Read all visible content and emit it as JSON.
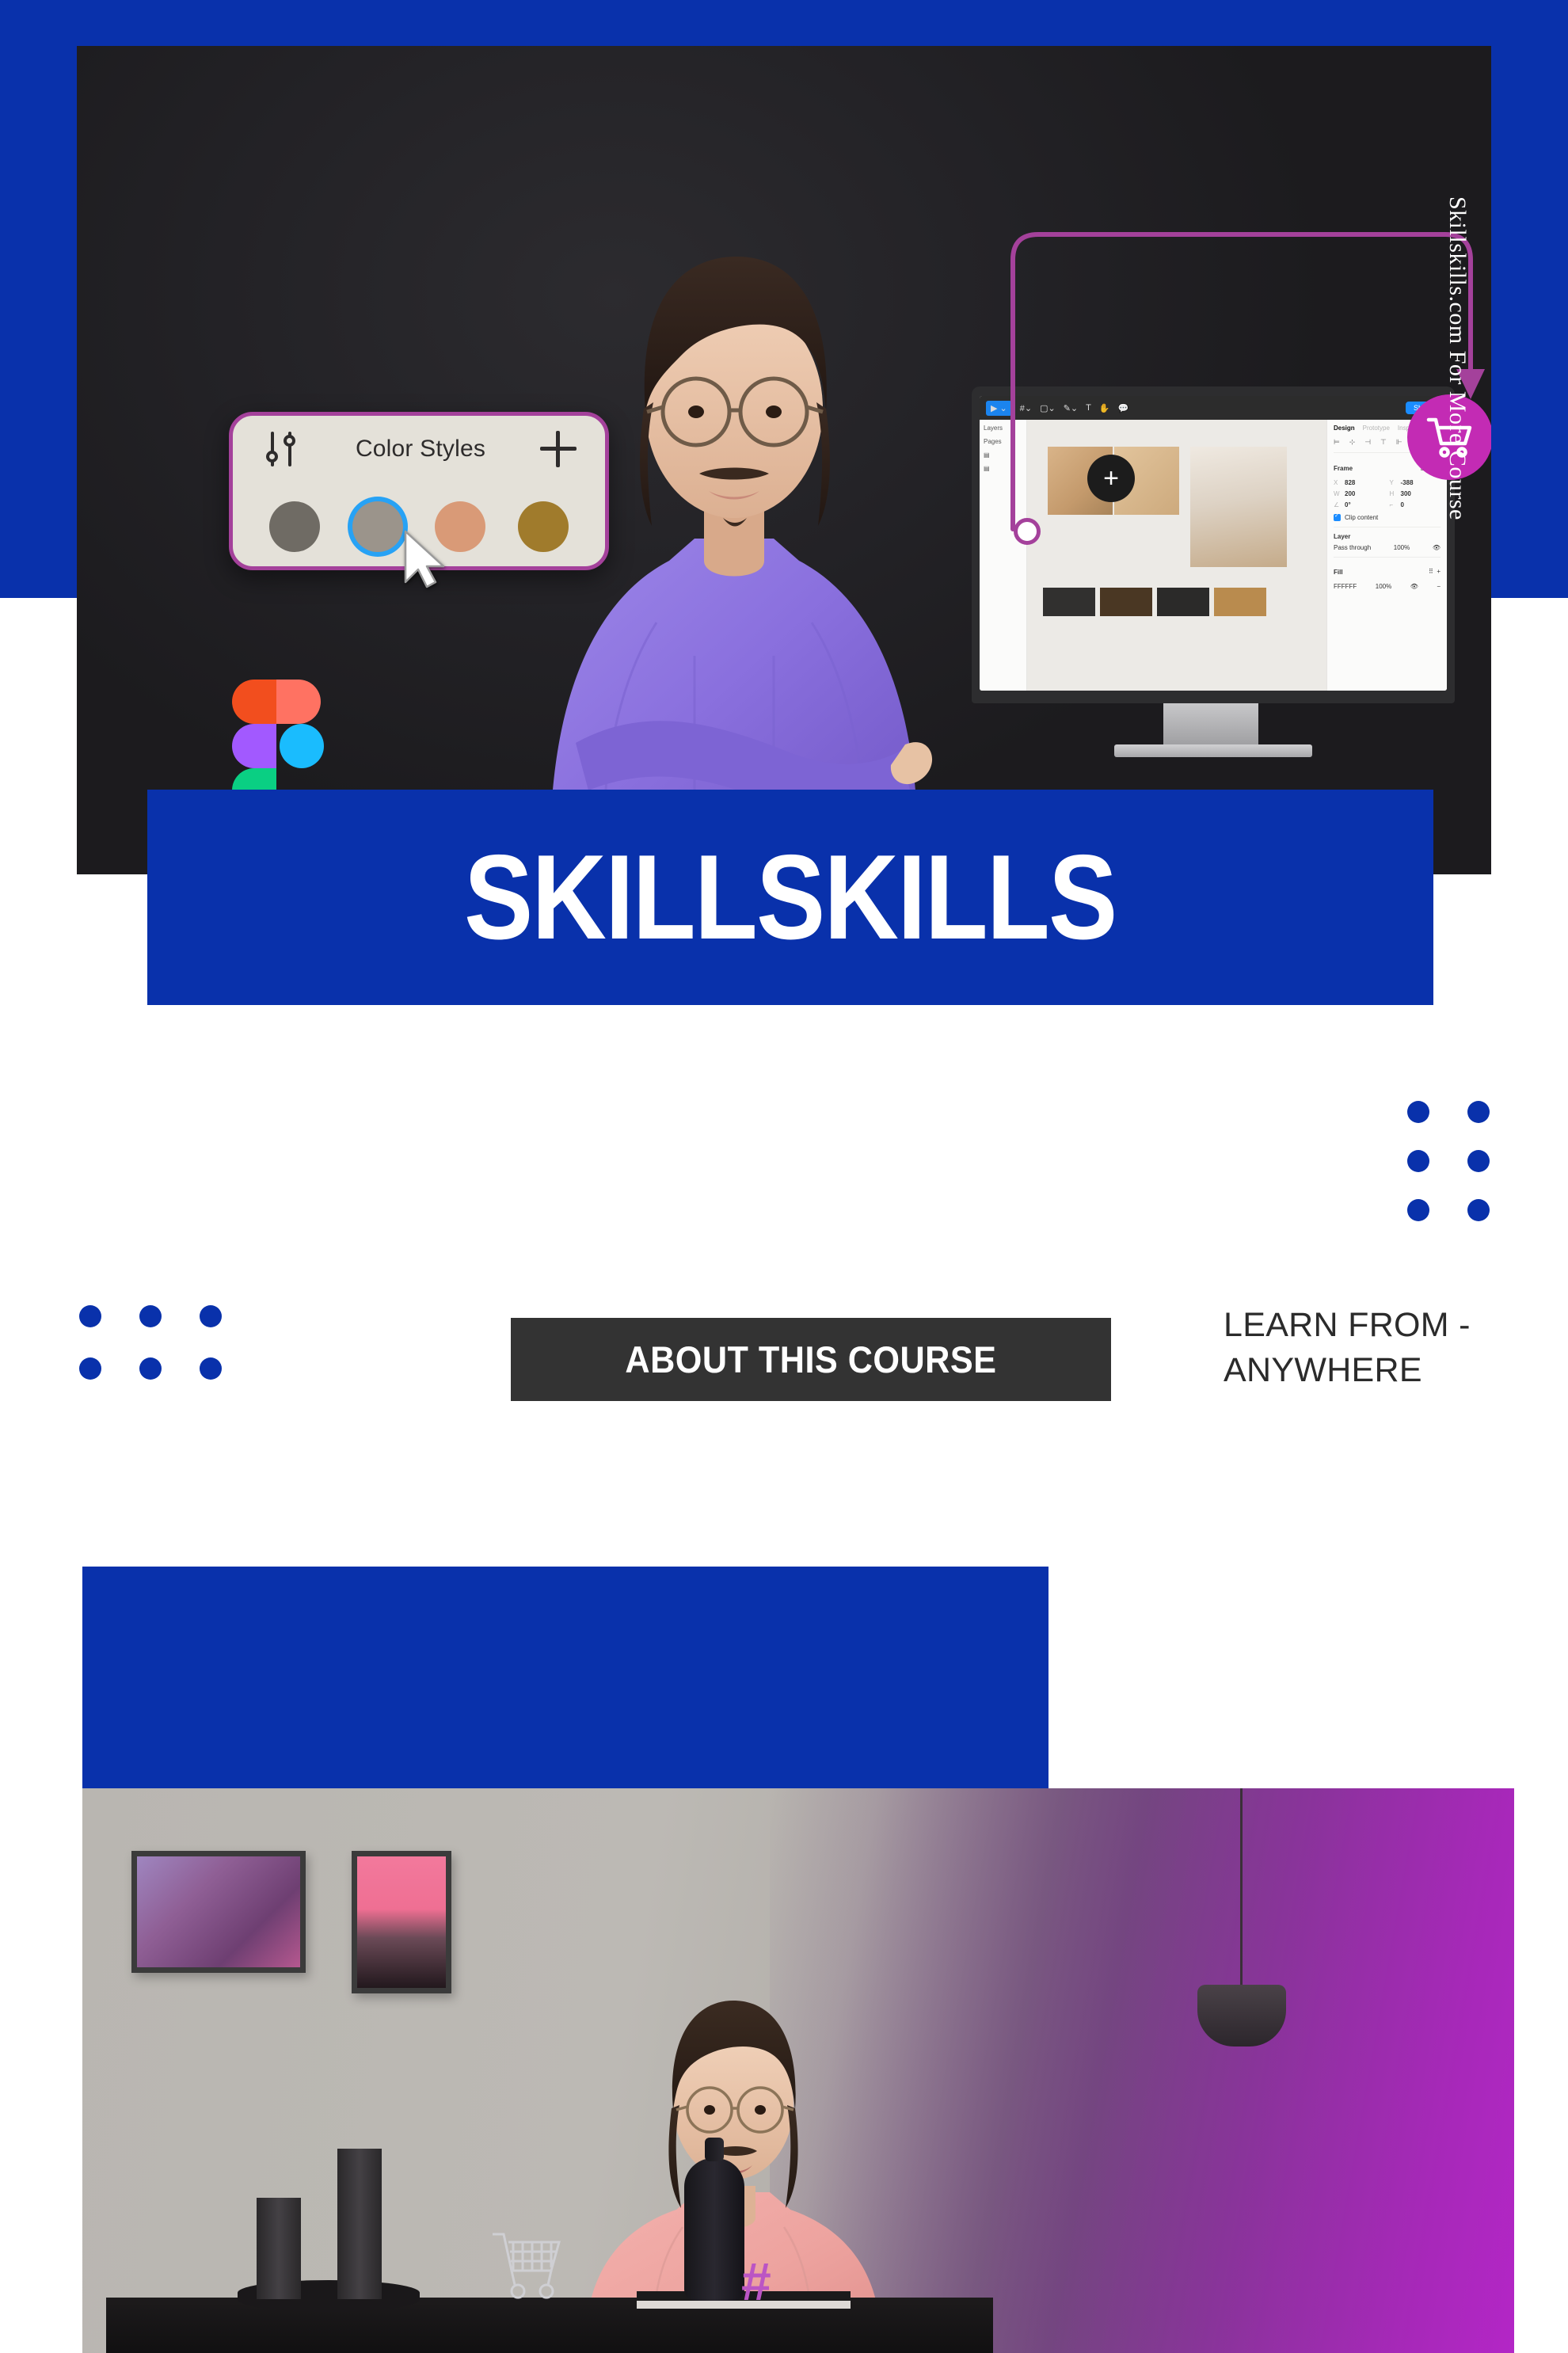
{
  "brand": {
    "title": "SKILLSKILLS",
    "accent_blue": "#0931AB",
    "accent_magenta": "#C32BB4",
    "dark": "#333333",
    "watermark": "Skillskills.com For More Course"
  },
  "hero": {
    "color_card": {
      "title": "Color Styles",
      "add_label": "+",
      "sliders_icon": "sliders-icon",
      "swatches": [
        {
          "name": "swatch-grey-dark",
          "hex": "#6F6B64",
          "selected": false
        },
        {
          "name": "swatch-grey-mid",
          "hex": "#9B948B",
          "selected": true
        },
        {
          "name": "swatch-peach",
          "hex": "#D99A77",
          "selected": false
        },
        {
          "name": "swatch-ochre",
          "hex": "#A07B2C",
          "selected": false
        }
      ],
      "cursor_icon": "cursor-arrow-icon"
    },
    "figma_logo_label": "figma-logo",
    "cart_icon": "shopping-cart-icon"
  },
  "figma_ui": {
    "toolbar": {
      "move_tool": "move-tool-icon",
      "frame_tool": "frame-tool-icon",
      "shape_tool": "shape-tool-icon",
      "pen_tool": "pen-tool-icon",
      "text_tool": "T",
      "hand_tool": "hand-tool-icon",
      "comment_tool": "comment-tool-icon",
      "share_label": "Share"
    },
    "left_panel": {
      "layers_label": "Layers",
      "pages_label": "Pages"
    },
    "canvas": {
      "add_button_label": "+"
    },
    "right_panel": {
      "tabs": [
        "Design",
        "Prototype",
        "Inspect"
      ],
      "active_tab": "Design",
      "frame": {
        "section_label": "Frame",
        "x_label": "X",
        "x_value": "828",
        "y_label": "Y",
        "y_value": "-388",
        "w_label": "W",
        "w_value": "200",
        "h_label": "H",
        "h_value": "300",
        "rotation_label": "rotation",
        "rotation_value": "0°",
        "corner_label": "corner",
        "corner_value": "0",
        "clip_content_label": "Clip content",
        "clip_content_checked": true
      },
      "layer": {
        "section_label": "Layer",
        "blend_mode": "Pass through",
        "opacity": "100%"
      },
      "fill": {
        "section_label": "Fill",
        "color_hex": "FFFFFF",
        "opacity": "100%"
      }
    }
  },
  "middle": {
    "about_chip_label": "ABOUT THIS COURSE",
    "learn_from_line1": "LEARN FROM -",
    "learn_from_line2": "ANYWHERE",
    "dots_right": {
      "name": "dot-grid-right",
      "cols": 2,
      "rows": 3
    },
    "dots_left": {
      "name": "dot-grid-left",
      "cols": 3,
      "rows": 2
    }
  },
  "bottom": {
    "blue_block_label": "blue-accent-block",
    "photo_label": "instructor-interior-photo"
  }
}
